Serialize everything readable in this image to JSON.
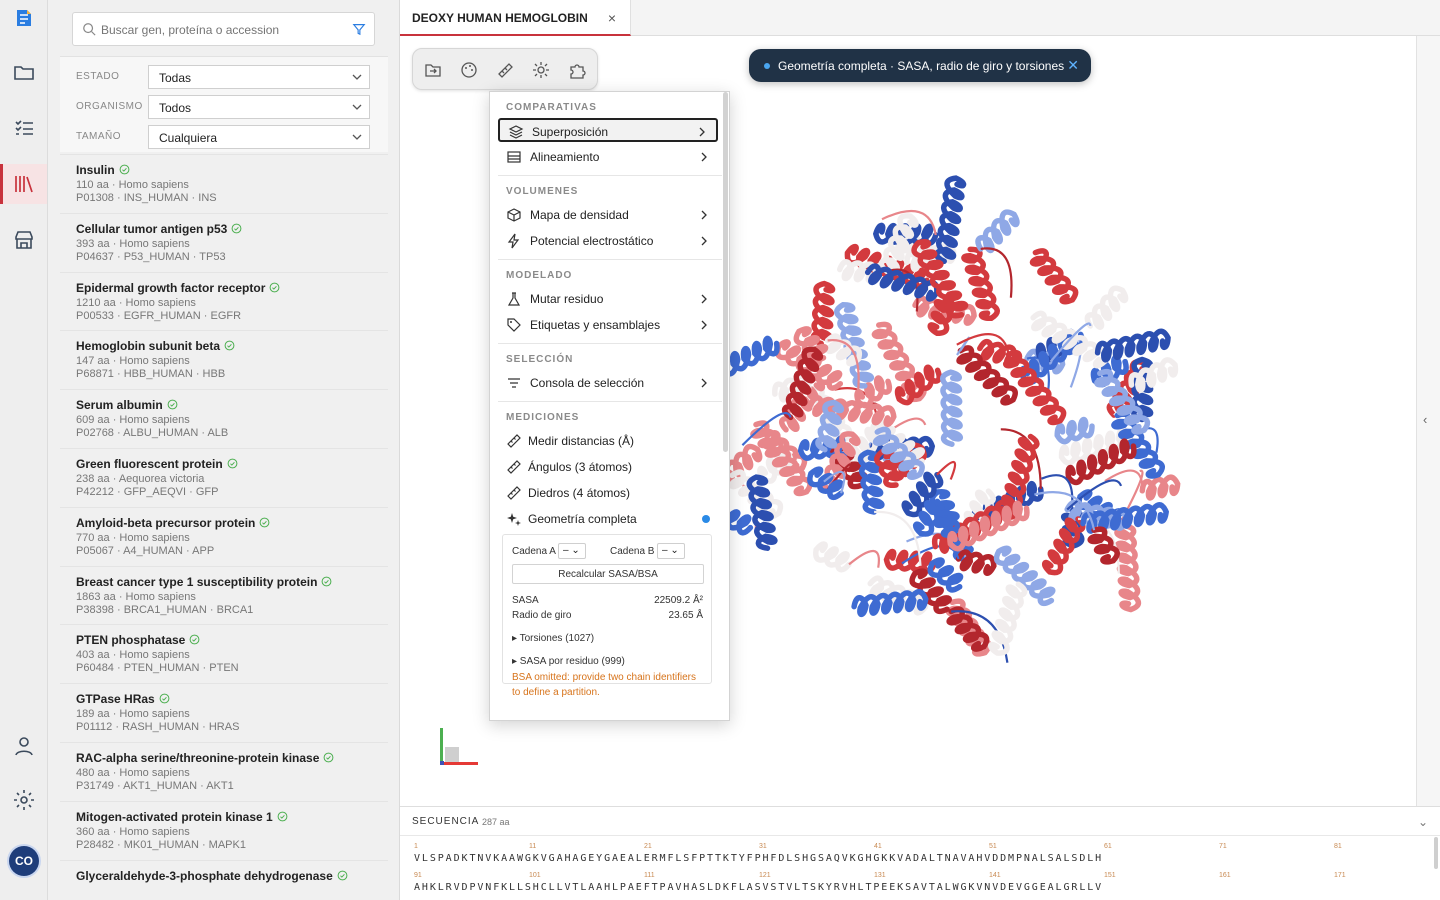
{
  "sidebar": {
    "search_placeholder": "Buscar gen, proteína o accession",
    "filters": [
      {
        "label": "ESTADO",
        "value": "Todas"
      },
      {
        "label": "ORGANISMO",
        "value": "Todos"
      },
      {
        "label": "TAMAÑO",
        "value": "Cualquiera"
      }
    ],
    "proteins": [
      {
        "name": "Insulin",
        "meta1": "110 aa · Homo sapiens",
        "meta2": "P01308 · INS_HUMAN · INS"
      },
      {
        "name": "Cellular tumor antigen p53",
        "meta1": "393 aa · Homo sapiens",
        "meta2": "P04637 · P53_HUMAN · TP53"
      },
      {
        "name": "Epidermal growth factor receptor",
        "meta1": "1210 aa · Homo sapiens",
        "meta2": "P00533 · EGFR_HUMAN · EGFR"
      },
      {
        "name": "Hemoglobin subunit beta",
        "meta1": "147 aa · Homo sapiens",
        "meta2": "P68871 · HBB_HUMAN · HBB"
      },
      {
        "name": "Serum albumin",
        "meta1": "609 aa · Homo sapiens",
        "meta2": "P02768 · ALBU_HUMAN · ALB"
      },
      {
        "name": "Green fluorescent protein",
        "meta1": "238 aa · Aequorea victoria",
        "meta2": "P42212 · GFP_AEQVI · GFP"
      },
      {
        "name": "Amyloid-beta precursor protein",
        "meta1": "770 aa · Homo sapiens",
        "meta2": "P05067 · A4_HUMAN · APP"
      },
      {
        "name": "Breast cancer type 1 susceptibility protein",
        "meta1": "1863 aa · Homo sapiens",
        "meta2": "P38398 · BRCA1_HUMAN · BRCA1"
      },
      {
        "name": "PTEN phosphatase",
        "meta1": "403 aa · Homo sapiens",
        "meta2": "P60484 · PTEN_HUMAN · PTEN"
      },
      {
        "name": "GTPase HRas",
        "meta1": "189 aa · Homo sapiens",
        "meta2": "P01112 · RASH_HUMAN · HRAS"
      },
      {
        "name": "RAC-alpha serine/threonine-protein kinase",
        "meta1": "480 aa · Homo sapiens",
        "meta2": "P31749 · AKT1_HUMAN · AKT1"
      },
      {
        "name": "Mitogen-activated protein kinase 1",
        "meta1": "360 aa · Homo sapiens",
        "meta2": "P28482 · MK01_HUMAN · MAPK1"
      },
      {
        "name": "Glyceraldehyde-3-phosphate dehydrogenase",
        "meta1": "",
        "meta2": ""
      }
    ]
  },
  "user": {
    "initials": "CO"
  },
  "tab": {
    "label": "DEOXY HUMAN HEMOGLOBIN",
    "close": "×"
  },
  "toast": {
    "text": "Geometría completa · SASA, radio de giro y torsiones",
    "close": "✕"
  },
  "menu": {
    "sections": {
      "comparativas": "COMPARATIVAS",
      "volumenes": "VOLUMENES",
      "modelado": "MODELADO",
      "seleccion": "SELECCIÓN",
      "mediciones": "MEDICIONES"
    },
    "items": {
      "superposicion": "Superposición",
      "alineamiento": "Alineamiento",
      "densidad": "Mapa de densidad",
      "potencial": "Potencial electrostático",
      "mutar": "Mutar residuo",
      "etiquetas": "Etiquetas y ensamblajes",
      "consola": "Consola de selección",
      "distancias": "Medir distancias (Å)",
      "angulos": "Ángulos (3 átomos)",
      "diedros": "Diedros (4 átomos)",
      "geometria": "Geometría completa"
    },
    "geometry": {
      "chain_a_label": "Cadena A",
      "chain_a_value": "–",
      "chain_b_label": "Cadena B",
      "chain_b_value": "–",
      "recalc": "Recalcular SASA/BSA",
      "sasa_label": "SASA",
      "sasa_value": "22509.2 Å²",
      "rg_label": "Radio de giro",
      "rg_value": "23.65 Å",
      "torsions": "▸ Torsiones (1027)",
      "sasa_res": "▸ SASA por residuo (999)",
      "warning": "BSA omitted: provide two chain identifiers to define a partition."
    }
  },
  "sequence": {
    "title": "SECUENCIA",
    "length": "287 aa",
    "row1": "VLSPADKTNVKAAWGKVGAHAGEYGAEALERMFLSFPTTKTYFPHFDLSHGSAQVKGHGKKVADALTNAVAHVDDMPNALSALSDLH",
    "row2": "AHKLRVDPVNFKLLSHCLLVTLAAHLPAEFTPAVHASLDKFLASVSTVLTSKYRVHLTPEEKSAVTALWGKVNVDEVGGEALGRLLV",
    "nums1": [
      "1",
      "11",
      "21",
      "31",
      "41",
      "51",
      "61",
      "71",
      "81"
    ],
    "nums2": [
      "91",
      "101",
      "111",
      "121",
      "131",
      "141",
      "151",
      "161",
      "171"
    ]
  },
  "colors": {
    "accent": "#c8323c",
    "toast_bg": "#203246",
    "warn": "#d7741c",
    "helix_red": "#d33a3e",
    "helix_blue": "#3e6bd2",
    "helix_white": "#f1eded"
  }
}
